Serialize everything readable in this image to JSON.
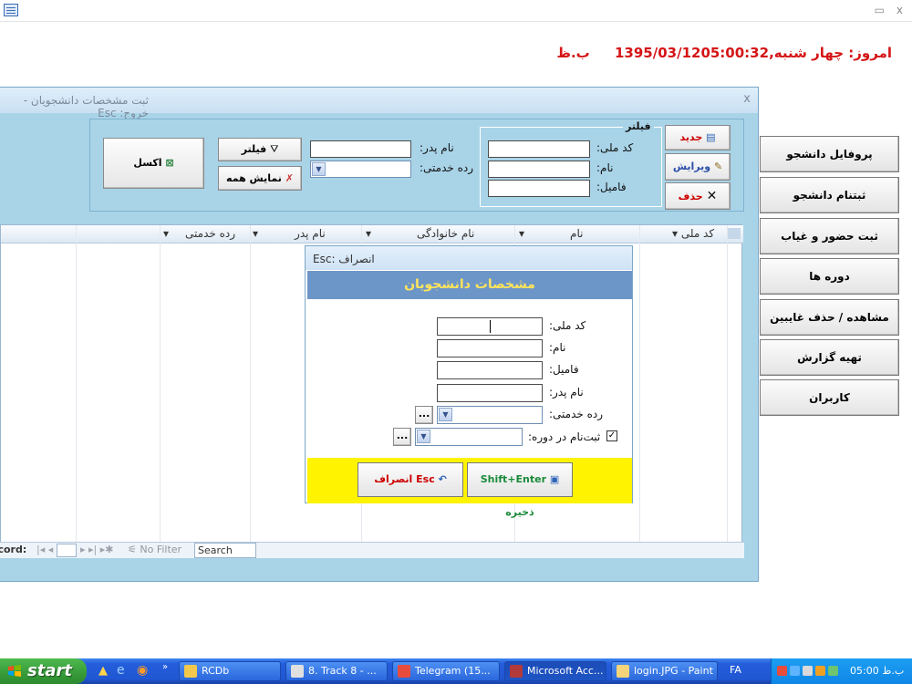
{
  "datetime": {
    "time": "05:00:32 ب.ظ",
    "date_label": "امروز: چهار شنبه,1395/03/12"
  },
  "form": {
    "title": "ثبت مشخصات دانشجویان - خروج: Esc",
    "close": "x",
    "filter": {
      "legend": "فیلتر",
      "national_code_label": "کد ملی:",
      "name_label": "نام:",
      "family_label": "فامیل:",
      "father_label": "نام پدر:",
      "rank_label": "رده خدمتی:",
      "filter_button": "فیلتر",
      "show_all_button": "نمایش همه",
      "excel_button": "اکسل"
    },
    "actions": {
      "new": "جدید",
      "edit": "ویرایش",
      "delete": "حذف"
    },
    "grid": {
      "columns": [
        "کد ملی",
        "نام",
        "نام خانوادگی",
        "نام پدر",
        "رده خدمتی"
      ]
    },
    "record_bar": {
      "label": "ecord:",
      "nav": "|◂  ◂",
      "nav2": "▸  ▸|  ▸✱",
      "no_filter": "No Filter",
      "search": "Search"
    }
  },
  "menu": {
    "items": [
      "پروفایل دانشجو",
      "ثبتنام دانشجو",
      "ثبت حضور و غیاب",
      "دوره ها",
      "مشاهده / حذف غایبین",
      "تهیه گزارش",
      "کاربران"
    ]
  },
  "dialog": {
    "title": "انصراف :Esc",
    "header": "مشخصات دانشجویان",
    "fields": {
      "national_code": "کد ملی:",
      "name": "نام:",
      "family": "فامیل:",
      "father": "نام پدر:",
      "rank": "رده خدمتی:",
      "course": "ثبت‌نام در دوره:"
    },
    "course_checked": true,
    "ellipsis": "...",
    "save_button": "Shift+Enter ذخیره",
    "cancel_button": "Esc انصراف"
  },
  "taskbar": {
    "start": "start",
    "tasks": [
      "RCDb",
      "8. Track 8 - ...",
      "Telegram (15...",
      "Microsoft Acc...",
      "login.JPG - Paint"
    ],
    "lang": "FA",
    "clock": "ب.ظ 05:00"
  },
  "colors": {
    "form_bg": "#a9d4e8",
    "datetime": "#d51416",
    "dialog_header": "#6d96c8",
    "dialog_header_text": "#ffe45a",
    "dialog_footer": "#fff300",
    "taskbar": "#245edb"
  }
}
